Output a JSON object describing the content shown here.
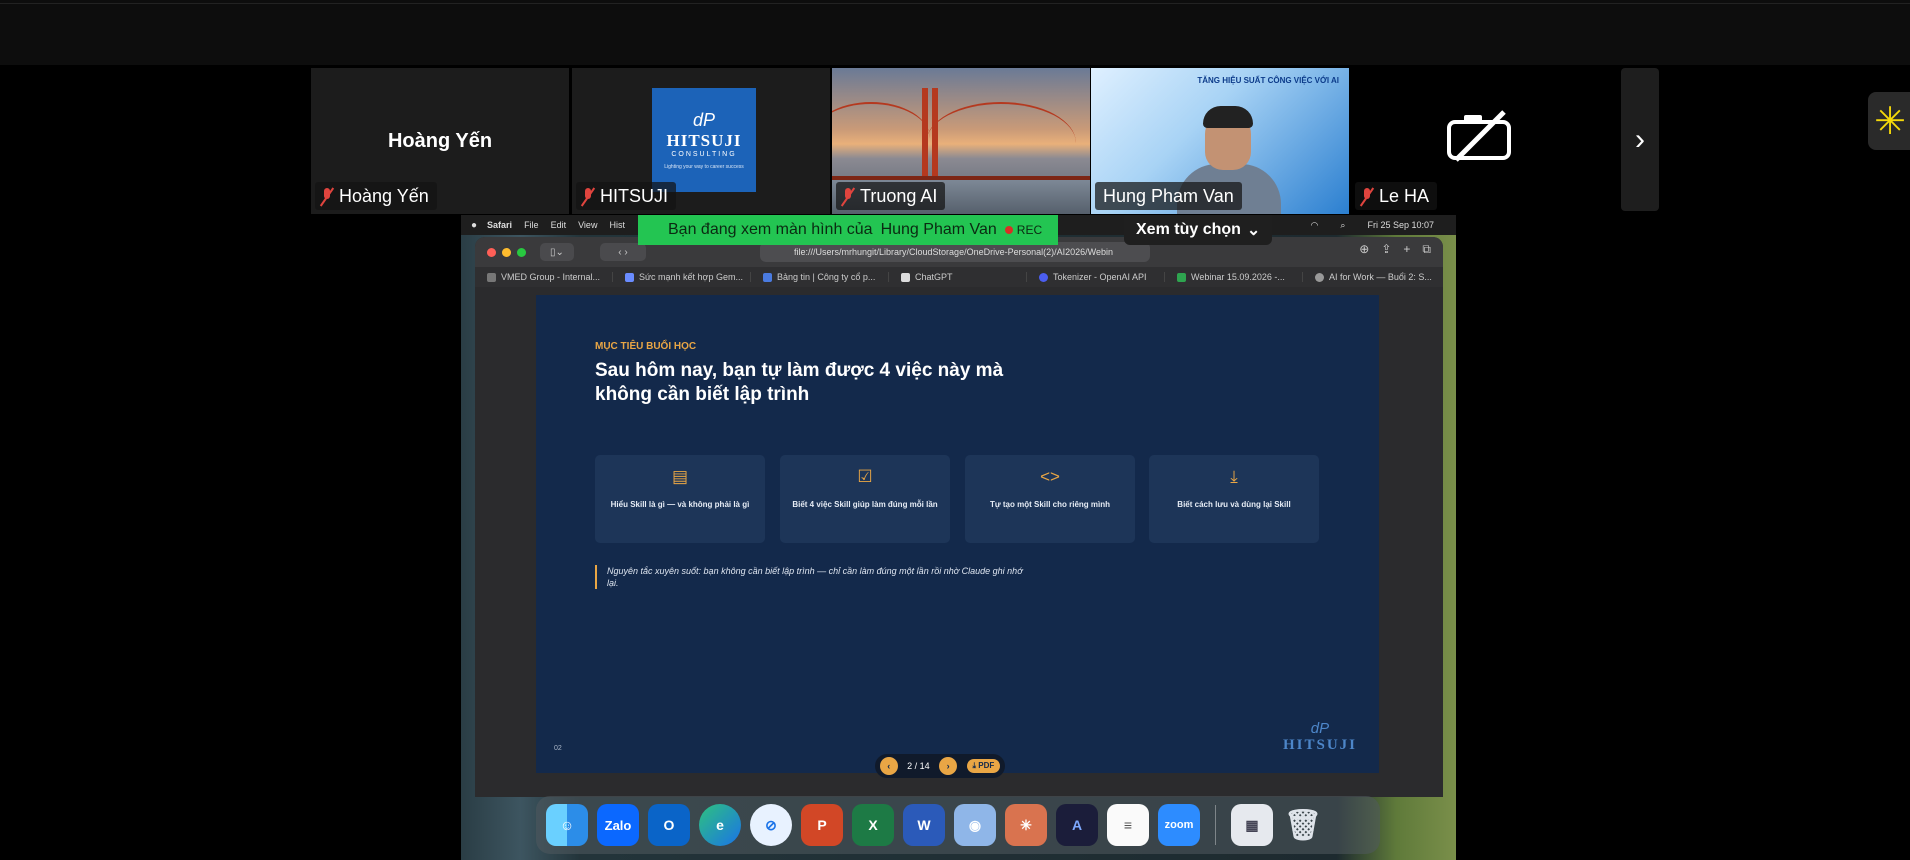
{
  "gallery": {
    "tiles": [
      {
        "name": "Hoàng Yến",
        "display_name": "Hoàng Yến"
      },
      {
        "name": "HITSUJI",
        "logo_mark": "dP",
        "logo_brand": "HITSUJI",
        "logo_sub": "CONSULTING",
        "logo_tag": "Lighting your way to career success"
      },
      {
        "name": "Truong AI"
      },
      {
        "name": "Hung Pham Van",
        "banner": "TĂNG HIỆU SUẤT CÔNG VIỆC VỚI AI"
      },
      {
        "name": "Le HA"
      }
    ]
  },
  "share": {
    "banner_prefix": "Bạn đang xem màn hình của",
    "host": "Hung Pham Van",
    "rec": "REC",
    "view_options": "Xem tùy chọn"
  },
  "mac_menu": {
    "items": [
      "Safari",
      "File",
      "Edit",
      "View",
      "Hist"
    ],
    "clock": "Fri 25 Sep  10:07"
  },
  "browser": {
    "url": "file:///Users/mrhungit/Library/CloudStorage/OneDrive-Personal(2)/AI2026/Webin",
    "tabs": [
      "VMED Group - Internal...",
      "Sức mạnh kết hợp Gem...",
      "Bảng tin | Công ty cổ p...",
      "ChatGPT",
      "Tokenizer - OpenAI API",
      "Webinar 15.09.2026 -...",
      "AI for Work — Buổi 2: S..."
    ]
  },
  "slide": {
    "kicker": "MỤC TIÊU BUỔI HỌC",
    "title": "Sau hôm nay, bạn tự làm được 4 việc này mà không cần biết lập trình",
    "cards": [
      {
        "icon": "document-icon",
        "text": "Hiểu Skill là gì — và không phải là gì"
      },
      {
        "icon": "checkbox-icon",
        "text": "Biết 4 việc Skill giúp làm đúng mỗi lần"
      },
      {
        "icon": "code-icon",
        "text": "Tự tạo một Skill cho riêng mình"
      },
      {
        "icon": "download-icon",
        "text": "Biết cách lưu và dùng lại Skill"
      }
    ],
    "quote": "Nguyên tắc xuyên suốt: bạn không cần biết lập trình — chỉ cần làm đúng một lần rồi nhờ Claude ghi nhớ lại.",
    "page_number": "02",
    "logo_mark": "dP",
    "logo_brand": "HITSUJI",
    "pager": {
      "text": "2 / 14",
      "pdf": "PDF"
    },
    "accent": "#e9a645",
    "background": "#13294b"
  },
  "dock": {
    "apps": [
      "Finder",
      "Zalo",
      "Outlook",
      "Edge",
      "Safari",
      "PowerPoint",
      "Excel",
      "Word",
      "Preview",
      "Claude",
      "Affinity",
      "TextEdit",
      "zoom",
      "Files",
      "Trash"
    ],
    "zalo_label": "Zalo",
    "zoom_label": "zoom"
  }
}
